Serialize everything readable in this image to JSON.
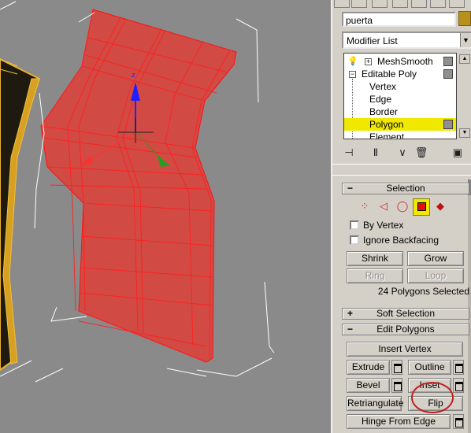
{
  "object_name": "puerta",
  "modifier_list": {
    "label": "Modifier List"
  },
  "stack": {
    "items": [
      {
        "label": "MeshSmooth"
      },
      {
        "label": "Editable Poly"
      },
      {
        "label": "Vertex"
      },
      {
        "label": "Edge"
      },
      {
        "label": "Border"
      },
      {
        "label": "Polygon"
      },
      {
        "label": "Element"
      }
    ]
  },
  "selection_rollout": {
    "title": "Selection",
    "by_vertex": "By Vertex",
    "ignore_backfacing": "Ignore Backfacing",
    "shrink": "Shrink",
    "grow": "Grow",
    "ring": "Ring",
    "loop": "Loop",
    "status": "24 Polygons Selected"
  },
  "soft_selection_rollout": {
    "title": "Soft Selection"
  },
  "edit_polygons_rollout": {
    "title": "Edit Polygons",
    "insert_vertex": "Insert Vertex",
    "extrude": "Extrude",
    "outline": "Outline",
    "bevel": "Bevel",
    "inset": "Inset",
    "retriangulate": "Retriangulate",
    "flip": "Flip",
    "hinge_from_edge": "Hinge From Edge"
  },
  "colors": {
    "viewport_bg": "#8a8a8a",
    "selected_poly": "#d83a3a",
    "object_color": "#b8901c",
    "highlight": "#f0e800",
    "annotation": "#c02020"
  }
}
